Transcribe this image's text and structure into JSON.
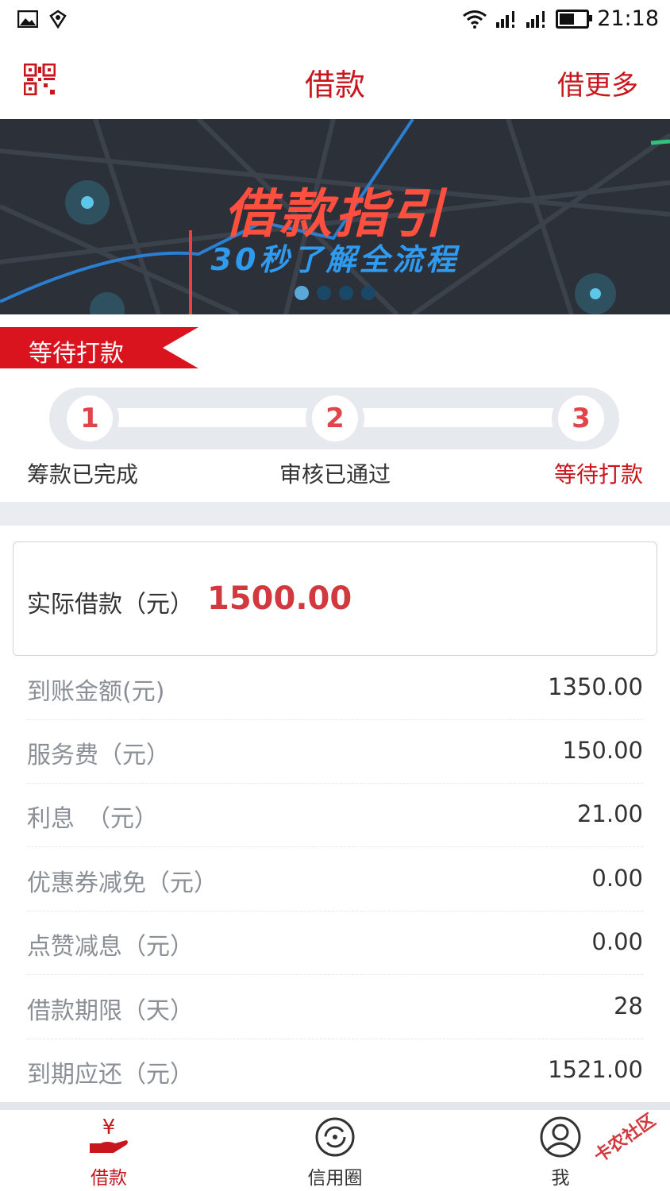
{
  "status_bar": {
    "time": "21:18"
  },
  "header": {
    "title": "借款",
    "right_link": "借更多"
  },
  "banner": {
    "title": "借款指引",
    "subtitle": "30秒了解全流程",
    "slide_count": 4,
    "active_slide": 1
  },
  "status_ribbon": {
    "label": "等待打款"
  },
  "steps": [
    {
      "number": "1",
      "label": "筹款已完成"
    },
    {
      "number": "2",
      "label": "审核已通过"
    },
    {
      "number": "3",
      "label": "等待打款"
    }
  ],
  "actual_loan": {
    "label": "实际借款（元）",
    "value": "1500.00"
  },
  "details": [
    {
      "label": "到账金额(元)",
      "value": "1350.00"
    },
    {
      "label": "服务费（元）",
      "value": "150.00"
    },
    {
      "label": "利息　（元）",
      "value": "21.00"
    },
    {
      "label": "优惠券减免（元）",
      "value": "0.00"
    },
    {
      "label": "点赞减息（元）",
      "value": "0.00"
    },
    {
      "label": "借款期限（天）",
      "value": "28"
    },
    {
      "label": "到期应还（元）",
      "value": "1521.00"
    }
  ],
  "bottom_nav": [
    {
      "label": "借款",
      "icon": "yen-hand-icon"
    },
    {
      "label": "信用圈",
      "icon": "circle-icon"
    },
    {
      "label": "我",
      "icon": "user-icon"
    }
  ],
  "watermark": "卡农社区",
  "colors": {
    "brand_red": "#c8161d",
    "amount_red": "#d2393f",
    "banner_bg": "#2c3038"
  }
}
